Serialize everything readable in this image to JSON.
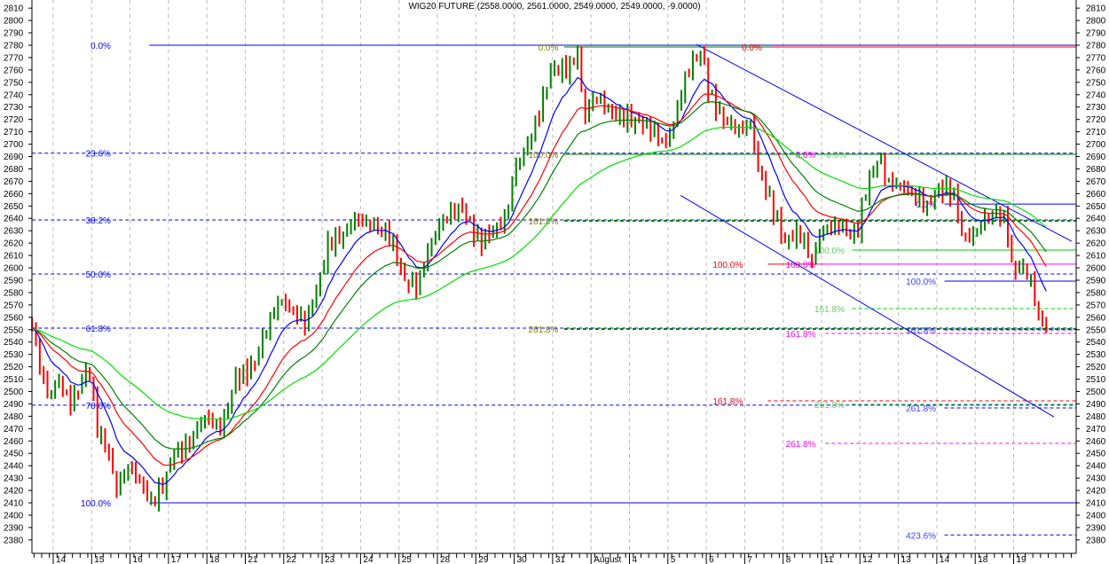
{
  "chart_data": {
    "type": "candlestick",
    "title": "WIG20 FUTURE (2558.0000, 2561.0000, 2549.0000, 2549.0000, -9.0000)",
    "ylim": [
      2375,
      2815
    ],
    "y_ticks": [
      2380,
      2390,
      2400,
      2410,
      2420,
      2430,
      2440,
      2450,
      2460,
      2470,
      2480,
      2490,
      2500,
      2510,
      2520,
      2530,
      2540,
      2550,
      2560,
      2570,
      2580,
      2590,
      2600,
      2610,
      2620,
      2630,
      2640,
      2650,
      2660,
      2670,
      2680,
      2690,
      2700,
      2710,
      2720,
      2730,
      2740,
      2750,
      2760,
      2770,
      2780,
      2790,
      2800,
      2810
    ],
    "x_ticks": [
      "14",
      "15",
      "16",
      "17",
      "18",
      "21",
      "22",
      "23",
      "24",
      "25",
      "28",
      "29",
      "30",
      "31",
      "August",
      "4",
      "5",
      "6",
      "7",
      "8",
      "11",
      "12",
      "13",
      "14",
      "18",
      "19"
    ],
    "x_range_days": [
      -0.55,
      26.5
    ],
    "price_path": [
      [
        -0.55,
        2555
      ],
      [
        -0.35,
        2520
      ],
      [
        -0.12,
        2495
      ],
      [
        0.12,
        2510
      ],
      [
        0.46,
        2490
      ],
      [
        0.92,
        2520
      ],
      [
        1.15,
        2470
      ],
      [
        1.5,
        2445
      ],
      [
        1.62,
        2420
      ],
      [
        1.96,
        2440
      ],
      [
        2.31,
        2425
      ],
      [
        2.54,
        2410
      ],
      [
        2.89,
        2425
      ],
      [
        3.12,
        2450
      ],
      [
        3.46,
        2455
      ],
      [
        3.93,
        2480
      ],
      [
        4.39,
        2470
      ],
      [
        4.73,
        2510
      ],
      [
        5.2,
        2520
      ],
      [
        5.54,
        2550
      ],
      [
        5.89,
        2575
      ],
      [
        6.24,
        2565
      ],
      [
        6.58,
        2555
      ],
      [
        6.93,
        2590
      ],
      [
        7.16,
        2620
      ],
      [
        7.51,
        2625
      ],
      [
        7.85,
        2640
      ],
      [
        8.31,
        2635
      ],
      [
        8.78,
        2625
      ],
      [
        9.12,
        2590
      ],
      [
        9.47,
        2585
      ],
      [
        9.82,
        2620
      ],
      [
        10.16,
        2640
      ],
      [
        10.62,
        2650
      ],
      [
        11.09,
        2620
      ],
      [
        11.43,
        2630
      ],
      [
        11.78,
        2640
      ],
      [
        12.01,
        2680
      ],
      [
        12.36,
        2700
      ],
      [
        12.7,
        2730
      ],
      [
        12.93,
        2760
      ],
      [
        13.39,
        2760
      ],
      [
        13.67,
        2775
      ],
      [
        13.81,
        2720
      ],
      [
        14.09,
        2740
      ],
      [
        14.55,
        2725
      ],
      [
        15.01,
        2720
      ],
      [
        15.47,
        2715
      ],
      [
        15.94,
        2700
      ],
      [
        16.17,
        2720
      ],
      [
        16.51,
        2760
      ],
      [
        16.86,
        2775
      ],
      [
        17.09,
        2740
      ],
      [
        17.44,
        2720
      ],
      [
        17.9,
        2710
      ],
      [
        18.13,
        2720
      ],
      [
        18.36,
        2680
      ],
      [
        18.71,
        2650
      ],
      [
        19.05,
        2620
      ],
      [
        19.4,
        2630
      ],
      [
        19.75,
        2605
      ],
      [
        19.98,
        2630
      ],
      [
        20.44,
        2635
      ],
      [
        20.9,
        2625
      ],
      [
        21.13,
        2660
      ],
      [
        21.48,
        2690
      ],
      [
        21.71,
        2670
      ],
      [
        22.17,
        2665
      ],
      [
        22.75,
        2650
      ],
      [
        23.09,
        2665
      ],
      [
        23.44,
        2660
      ],
      [
        23.67,
        2625
      ],
      [
        23.9,
        2625
      ],
      [
        24.25,
        2640
      ],
      [
        24.6,
        2645
      ],
      [
        24.83,
        2635
      ],
      [
        24.94,
        2600
      ],
      [
        25.29,
        2600
      ],
      [
        25.52,
        2580
      ],
      [
        25.64,
        2560
      ],
      [
        25.87,
        2552
      ]
    ],
    "moving_averages": [
      {
        "name": "ma-fast",
        "period": 10,
        "color": "#0000ff"
      },
      {
        "name": "ma-medium",
        "period": 20,
        "color": "#ff0000"
      },
      {
        "name": "ma-slow",
        "period": 30,
        "color": "#008000"
      },
      {
        "name": "ma-long",
        "period": 60,
        "color": "#00e000"
      }
    ],
    "up_color": "#008000",
    "down_color": "#ff0000",
    "fib_sets": [
      {
        "name": "fib-blue-main",
        "color": "#0000ff",
        "from": -0.55,
        "label_at": 1.5,
        "levels": [
          {
            "label": "0.0%",
            "price": 2780,
            "solid": true,
            "start": 2.5
          },
          {
            "label": "23.6%",
            "price": 2692.7
          },
          {
            "label": "38.2%",
            "price": 2638.7
          },
          {
            "label": "50.0%",
            "price": 2595
          },
          {
            "label": "61.8%",
            "price": 2551.3
          },
          {
            "label": "78.6%",
            "price": 2489
          },
          {
            "label": "100.0%",
            "price": 2410,
            "solid": true,
            "start": 2.5
          }
        ]
      },
      {
        "name": "fib-darkgreen",
        "color": "#008000",
        "labelColor": "#808000",
        "from": 13.3,
        "label_at": 13.15,
        "levels": [
          {
            "label": "0.0%",
            "price": 2778.6,
            "solid": true
          },
          {
            "label": "100.0%",
            "price": 2691.8,
            "solid": true
          },
          {
            "label": "161.8%",
            "price": 2638,
            "thick": true
          },
          {
            "label": "261.8%",
            "price": 2550.5,
            "thick": true
          }
        ]
      },
      {
        "name": "fib-red",
        "color": "#ff0000",
        "from": 18.6,
        "label_at": 18.45,
        "levels": [
          {
            "label": "0.0%",
            "price": 2778.6,
            "solid": true,
            "start": 18.7
          },
          {
            "label": "100.0%",
            "price": 2603,
            "solid": true,
            "end": 19.85,
            "start": 18.6,
            "label_at": 17.95
          },
          {
            "label": "161.8%",
            "price": 2492.5,
            "start": 18.6,
            "label_at": 17.95
          }
        ]
      },
      {
        "name": "fib-magenta",
        "color": "#ff00ff",
        "from": 19.4,
        "label_at": 19.85,
        "levels": [
          {
            "label": "0.0%",
            "price": 2691.8,
            "start": 19.85,
            "noline": true
          },
          {
            "label": "100.0%",
            "price": 2603,
            "solid": true,
            "start": 19.85,
            "label_at": 19.85
          },
          {
            "label": "161.8%",
            "price": 2547,
            "start": 20.1,
            "label_at": 19.85
          },
          {
            "label": "261.8%",
            "price": 2458,
            "start": 20.1,
            "label_at": 19.85
          }
        ]
      },
      {
        "name": "fib-lightgreen",
        "color": "#00cc00",
        "labelColor": "#66cc66",
        "from": 20.8,
        "label_at": 20.6,
        "levels": [
          {
            "label": "0.0%",
            "price": 2691.8,
            "noline": true,
            "label_at": 20.65
          },
          {
            "label": "100.0%",
            "price": 2614.4,
            "solid": true
          },
          {
            "label": "161.8%",
            "price": 2567
          },
          {
            "label": "261.8%",
            "price": 2489.6
          }
        ]
      },
      {
        "name": "fib-blue-right",
        "color": "#0000ff",
        "labelColor": "#4040ff",
        "from": 23.2,
        "label_at": 22.98,
        "levels": [
          {
            "label": "0.0%",
            "price": 2651.6,
            "solid": true
          },
          {
            "label": "100.0%",
            "price": 2589.3,
            "solid": true
          },
          {
            "label": "161.8%",
            "price": 2549.8
          },
          {
            "label": "261.8%",
            "price": 2486.7
          },
          {
            "label": "423.6%",
            "price": 2384
          }
        ]
      }
    ],
    "trendlines": [
      {
        "name": "channel-upper",
        "color": "#0000ff",
        "points": [
          [
            16.74,
            2780.7
          ],
          [
            26.51,
            2621.5
          ]
        ]
      },
      {
        "name": "channel-lower",
        "color": "#0000ff",
        "points": [
          [
            16.33,
            2658.6
          ],
          [
            26.05,
            2479.4
          ]
        ]
      }
    ]
  }
}
